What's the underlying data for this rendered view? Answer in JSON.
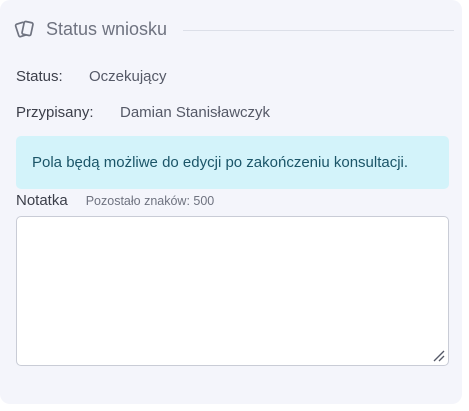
{
  "panel": {
    "title": "Status wniosku",
    "title_icon": "cards-icon"
  },
  "fields": {
    "status_label": "Status:",
    "status_value": "Oczekujący",
    "assignee_label": "Przypisany:",
    "assignee_value": "Damian Stanisławczyk"
  },
  "info": {
    "message": "Pola będą możliwe do edycji po zakończeniu konsultacji."
  },
  "note": {
    "label": "Notatka",
    "counter": "Pozostało znaków: 500",
    "value": "",
    "placeholder": ""
  },
  "colors": {
    "panel_background": "#f4f5fb",
    "info_background": "#d3f3fa",
    "info_text": "#1b5568"
  }
}
